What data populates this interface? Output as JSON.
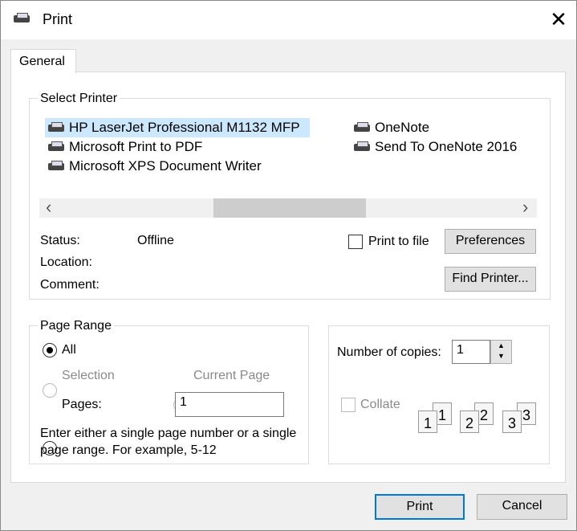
{
  "window": {
    "title": "Print",
    "close": "✕"
  },
  "tabs": [
    {
      "label": "General"
    }
  ],
  "select_printer": {
    "label": "Select Printer",
    "printers": [
      {
        "name": "HP LaserJet Professional M1132 MFP",
        "selected": true
      },
      {
        "name": "Microsoft Print to PDF"
      },
      {
        "name": "Microsoft XPS Document Writer"
      },
      {
        "name": "OneNote"
      },
      {
        "name": "Send To OneNote 2016"
      }
    ],
    "status_label": "Status:",
    "status_value": "Offline",
    "location_label": "Location:",
    "comment_label": "Comment:",
    "print_to_file": "Print to file",
    "preferences": "Preferences",
    "find_printer": "Find Printer...",
    "scroll_left": "‹",
    "scroll_right": "›"
  },
  "page_range": {
    "label": "Page Range",
    "all": "All",
    "selection": "Selection",
    "current_page": "Current Page",
    "pages": "Pages:",
    "pages_value": "1",
    "hint": "Enter either a single page number or a single page range.  For example, 5-12"
  },
  "copies": {
    "label": "Number of copies:",
    "value": "1",
    "collate": "Collate",
    "pages": [
      "1",
      "1",
      "2",
      "2",
      "3",
      "3"
    ]
  },
  "buttons": {
    "print": "Print",
    "cancel": "Cancel"
  },
  "colors": {
    "selection": "#cce8ff",
    "default_button_border": "#0078d7"
  }
}
